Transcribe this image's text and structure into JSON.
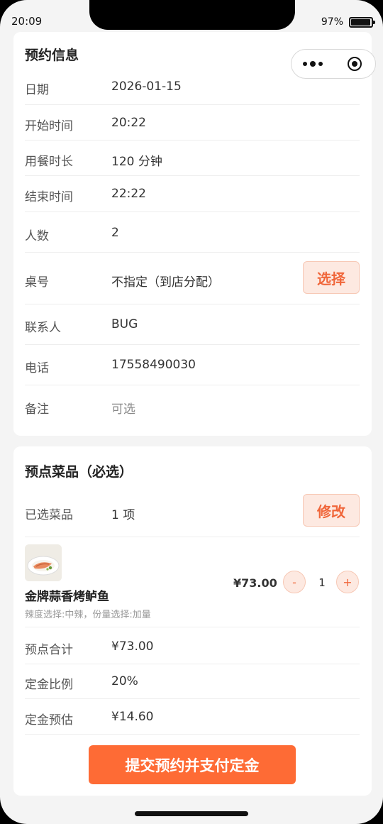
{
  "status_bar": {
    "time": "20:09",
    "battery": "97%",
    "battery_level": 0.97
  },
  "booking_info": {
    "title": "预约信息",
    "rows": [
      {
        "label": "日期",
        "value": "2026-01-15"
      },
      {
        "label": "开始时间",
        "value": "20:22"
      },
      {
        "label": "用餐时长",
        "value": "120 分钟"
      },
      {
        "label": "结束时间",
        "value": "22:22"
      },
      {
        "label": "人数",
        "value": "2"
      },
      {
        "label": "桌号",
        "value": "不指定（到店分配）",
        "button": "选择"
      },
      {
        "label": "联系人",
        "value": "BUG"
      },
      {
        "label": "电话",
        "value": "17558490030"
      },
      {
        "label": "备注",
        "placeholder": "可选"
      }
    ]
  },
  "preorder": {
    "title": "预点菜品（必选）",
    "selected_label": "已选菜品",
    "selected_value": "1 项",
    "modify_button": "修改",
    "dish": {
      "name": "金牌蒜香烤鲈鱼",
      "spec": "辣度选择:中辣，份量选择:加量",
      "price": "¥73.00",
      "minus": "-",
      "quantity": "1",
      "plus": "+"
    },
    "summary": [
      {
        "label": "预点合计",
        "value": "¥73.00"
      },
      {
        "label": "定金比例",
        "value": "20%"
      },
      {
        "label": "定金预估",
        "value": "¥14.60"
      }
    ],
    "submit_button": "提交预约并支付定金"
  },
  "colors": {
    "accent": "#fe6b35",
    "accent_light": "#fde9e1",
    "background": "#f4f4f4",
    "card": "#ffffff"
  }
}
